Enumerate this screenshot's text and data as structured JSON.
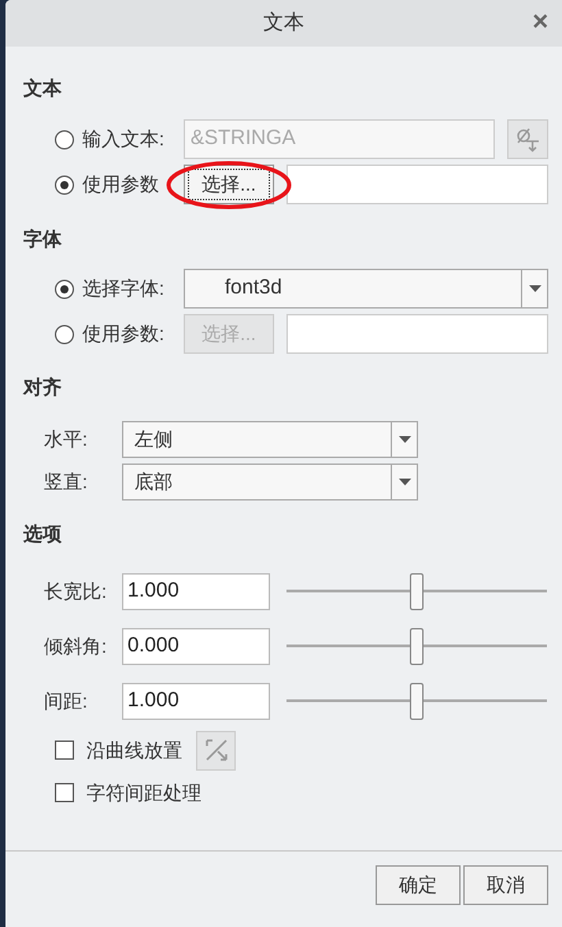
{
  "window": {
    "title": "文本",
    "close": "×"
  },
  "text_section": {
    "heading": "文本",
    "rows": [
      {
        "label": "输入文本:",
        "selected": false,
        "kind": "text",
        "value": "&STRINGA",
        "disabled": true
      },
      {
        "label": "使用参数",
        "selected": true,
        "kind": "param",
        "button": "选择...",
        "circled": true,
        "disabled": false
      }
    ]
  },
  "font_section": {
    "heading": "字体",
    "rows": [
      {
        "label": "选择字体:",
        "selected": true,
        "kind": "dropdown",
        "value": "font3d"
      },
      {
        "label": "使用参数:",
        "selected": false,
        "kind": "param",
        "button": "选择...",
        "circled": false,
        "disabled": true
      }
    ]
  },
  "align_section": {
    "heading": "对齐",
    "rows": [
      {
        "label": "水平:",
        "value": "左侧"
      },
      {
        "label": "竖直:",
        "value": "底部"
      }
    ]
  },
  "options_section": {
    "heading": "选项",
    "sliders": [
      {
        "label": "长宽比:",
        "value": "1.000",
        "level": 0.5
      },
      {
        "label": "倾斜角:",
        "value": "0.000",
        "level": 0.5
      },
      {
        "label": "间距:",
        "value": "1.000",
        "level": 0.5
      }
    ],
    "checks": [
      {
        "label": "沿曲线放置",
        "checked": false,
        "kind": "with_button"
      },
      {
        "label": "字符间距处理",
        "checked": false,
        "kind": "plain"
      }
    ]
  },
  "buttons": [
    "确定",
    "取消"
  ]
}
